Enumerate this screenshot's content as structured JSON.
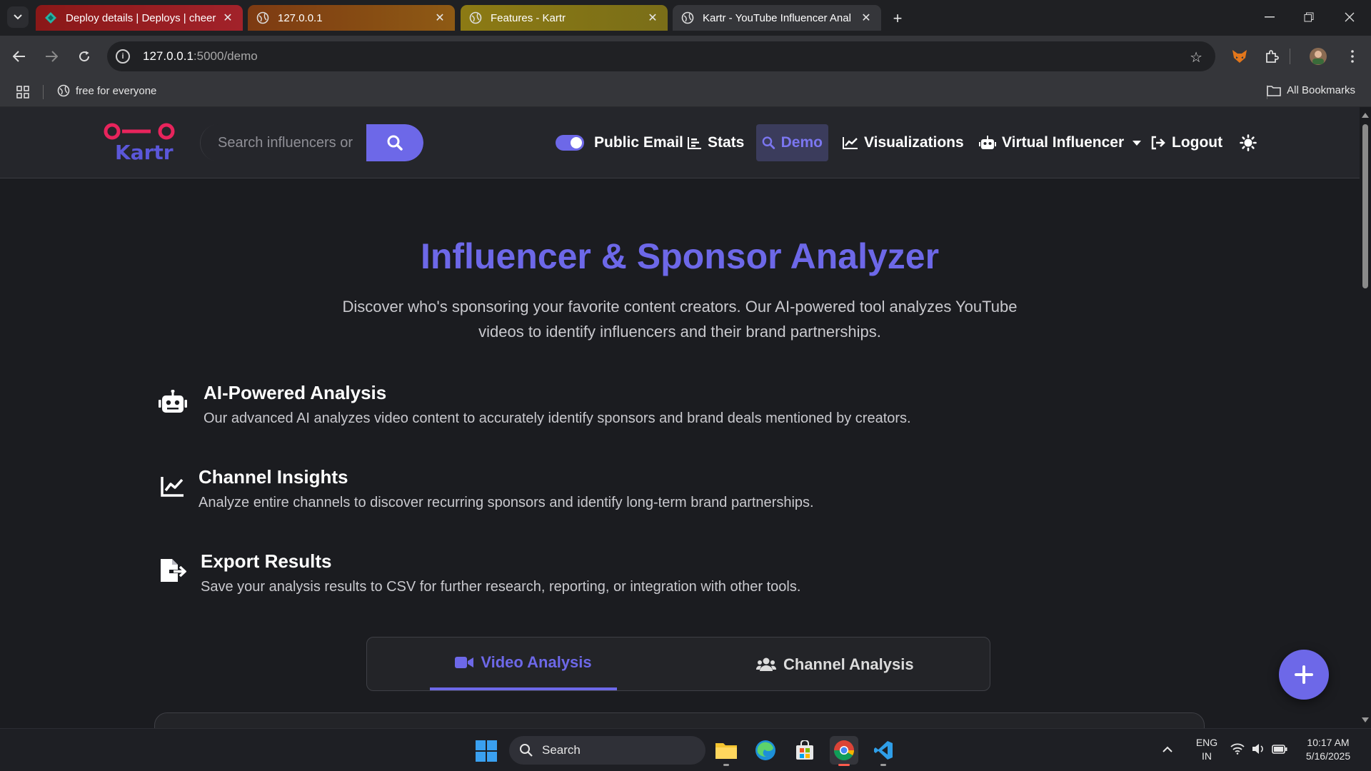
{
  "browser": {
    "tabs": [
      {
        "title": "Deploy details | Deploys | cheer",
        "favicon": "netlify-icon"
      },
      {
        "title": "127.0.0.1",
        "favicon": "globe-icon"
      },
      {
        "title": "Features - Kartr",
        "favicon": "globe-icon"
      },
      {
        "title": "Kartr - YouTube Influencer Anal",
        "favicon": "globe-icon"
      }
    ],
    "url_host": "127.0.0.1",
    "url_path": ":5000/demo",
    "bookmark": "free for everyone",
    "all_bookmarks": "All Bookmarks"
  },
  "nav": {
    "logo_text": "Kartr",
    "search_placeholder": "Search influencers or",
    "public_email": "Public Email",
    "stats": "Stats",
    "demo": "Demo",
    "visualizations": "Visualizations",
    "virtual_influencer": "Virtual Influencer",
    "logout": "Logout"
  },
  "hero": {
    "title": "Influencer & Sponsor Analyzer",
    "subtitle": "Discover who's sponsoring your favorite content creators. Our AI-powered tool analyzes YouTube videos to identify influencers and their brand partnerships."
  },
  "features": [
    {
      "title": "AI-Powered Analysis",
      "desc": "Our advanced AI analyzes video content to accurately identify sponsors and brand deals mentioned by creators.",
      "icon": "robot-icon"
    },
    {
      "title": "Channel Insights",
      "desc": "Analyze entire channels to discover recurring sponsors and identify long-term brand partnerships.",
      "icon": "chart-line-icon"
    },
    {
      "title": "Export Results",
      "desc": "Save your analysis results to CSV for further research, reporting, or integration with other tools.",
      "icon": "file-export-icon"
    }
  ],
  "analysis_tabs": {
    "video": "Video Analysis",
    "channel": "Channel Analysis"
  },
  "taskbar": {
    "search": "Search",
    "lang1": "ENG",
    "lang2": "IN",
    "time": "10:17 AM",
    "date": "5/16/2025"
  },
  "colors": {
    "accent": "#6d68e8",
    "logo_pink": "#e8245c",
    "background": "#1b1c20",
    "navbar": "#25262b"
  }
}
